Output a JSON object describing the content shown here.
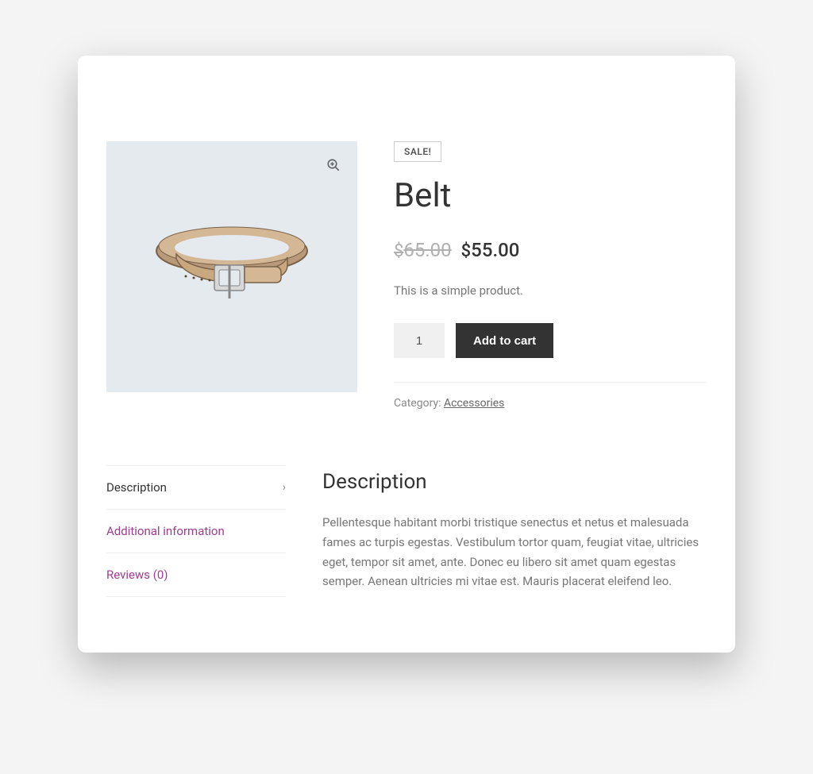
{
  "sale_badge": "SALE!",
  "product_title": "Belt",
  "price": {
    "currency": "$",
    "old": "65.00",
    "new": "55.00"
  },
  "short_description": "This is a simple product.",
  "quantity": "1",
  "add_to_cart_label": "Add to cart",
  "meta": {
    "category_label": "Category: ",
    "category_link": "Accessories"
  },
  "tabs": {
    "description": "Description",
    "additional_info": "Additional information",
    "reviews": "Reviews (0)"
  },
  "description_panel": {
    "title": "Description",
    "body": "Pellentesque habitant morbi tristique senectus et netus et malesuada fames ac turpis egestas. Vestibulum tortor quam, feugiat vitae, ultricies eget, tempor sit amet, ante. Donec eu libero sit amet quam egestas semper. Aenean ultricies mi vitae est. Mauris placerat eleifend leo."
  }
}
